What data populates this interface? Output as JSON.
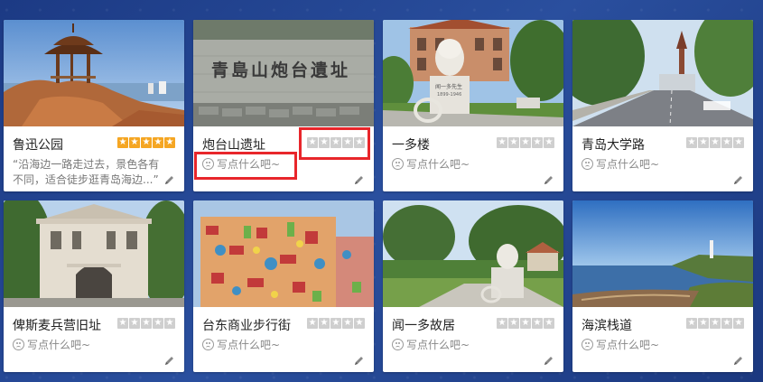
{
  "accent": "#f5a623",
  "highlight_color": "#e8262b",
  "cards": [
    {
      "name": "鲁迅公园",
      "rating": 5,
      "review": "“沿海边一路走过去，景色各有不同，适合徒步逛青岛海边...”"
    },
    {
      "name": "炮台山遗址",
      "rating": 0,
      "prompt": "写点什么吧~"
    },
    {
      "name": "一多楼",
      "rating": 0,
      "prompt": "写点什么吧~"
    },
    {
      "name": "青岛大学路",
      "rating": 0,
      "prompt": "写点什么吧~"
    },
    {
      "name": "俾斯麦兵营旧址",
      "rating": 0,
      "prompt": "写点什么吧~"
    },
    {
      "name": "台东商业步行街",
      "rating": 0,
      "prompt": "写点什么吧~"
    },
    {
      "name": "闻一多故居",
      "rating": 0,
      "prompt": "写点什么吧~"
    },
    {
      "name": "海滨栈道",
      "rating": 0,
      "prompt": "写点什么吧~"
    }
  ],
  "photo_texts": {
    "sign": "青島山炮台遺址",
    "bust_plaque": "闻一多先生",
    "bust_plaque_years": "1899-1946"
  },
  "icons": [
    "star-icon",
    "sad-face-icon",
    "pencil-icon"
  ]
}
